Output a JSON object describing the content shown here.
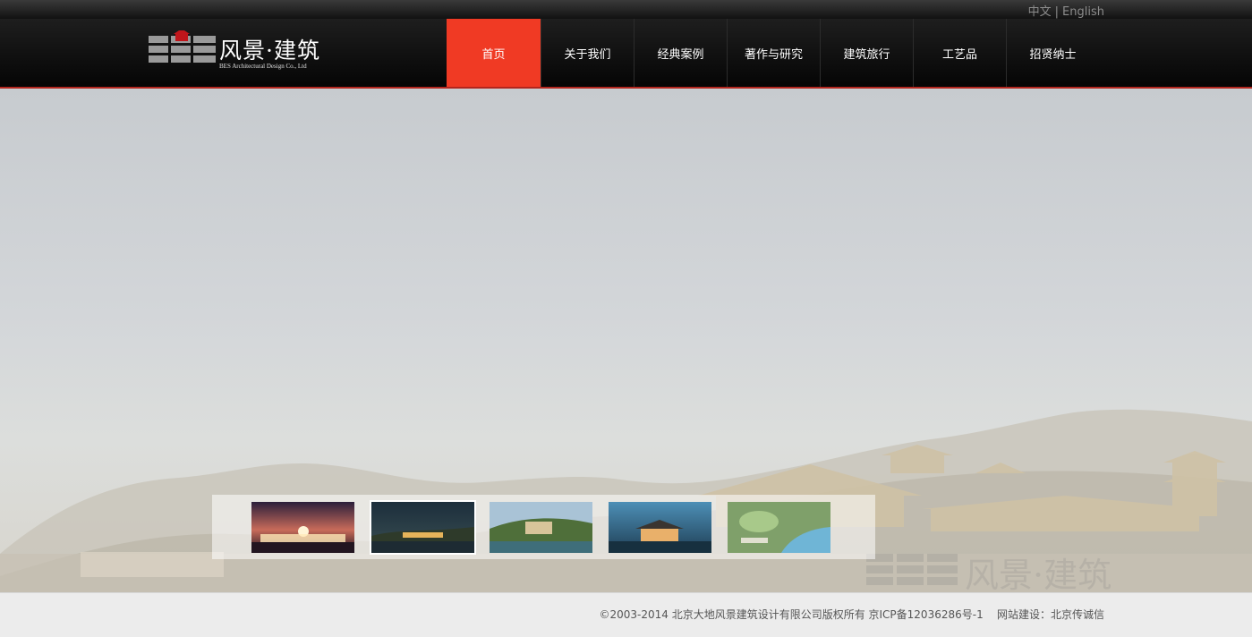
{
  "language_switch": {
    "chinese": "中文",
    "separator": "|",
    "english": "English"
  },
  "logo": {
    "title": "风景·建筑",
    "subtitle": "BES Architectural Design Co., Ltd"
  },
  "nav": {
    "items": [
      {
        "label": "首页",
        "active": true
      },
      {
        "label": "关于我们",
        "active": false
      },
      {
        "label": "经典案例",
        "active": false
      },
      {
        "label": "著作与研究",
        "active": false
      },
      {
        "label": "建筑旅行",
        "active": false
      },
      {
        "label": "工艺品",
        "active": false
      },
      {
        "label": "招贤纳士",
        "active": false
      }
    ]
  },
  "hero": {
    "watermark": "风景·建筑",
    "thumbnails": [
      {
        "name": "night-sunset-building"
      },
      {
        "name": "dusk-lakeside-building"
      },
      {
        "name": "hillside-resort"
      },
      {
        "name": "waterfront-hall"
      },
      {
        "name": "aerial-park-plan"
      }
    ]
  },
  "footer": {
    "copyright": "©2003-2014 北京大地风景建筑设计有限公司版权所有 京ICP备12036286号-1",
    "credit": "网站建设：北京传诚信"
  },
  "colors": {
    "accent": "#f03a24",
    "header_bg": "#0a0a0a",
    "footer_bg": "#ececec"
  }
}
